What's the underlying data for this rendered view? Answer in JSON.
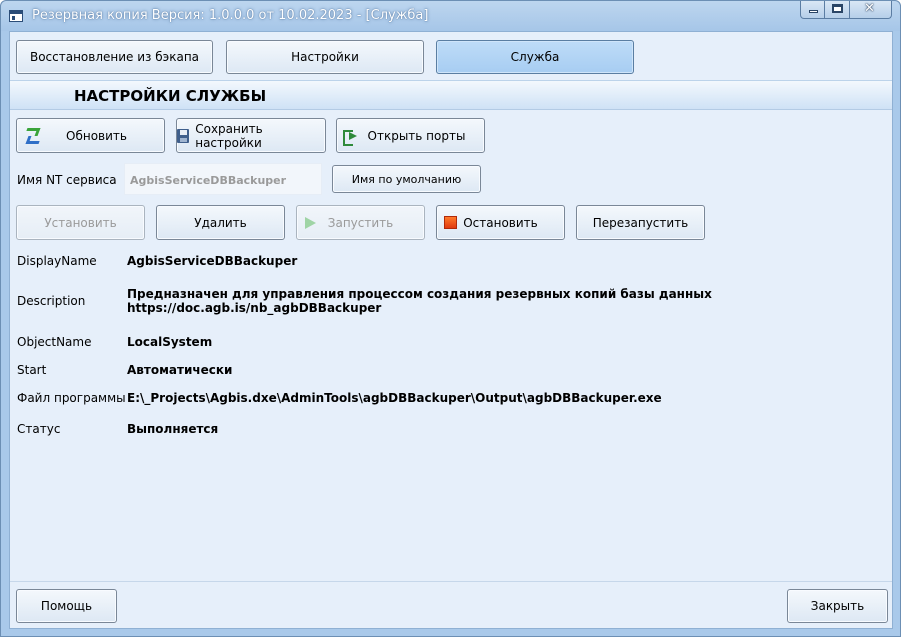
{
  "window": {
    "title": "Резервная копия   Версия: 1.0.0.0 от 10.02.2023 - [Служба]",
    "close_glyph": "✕"
  },
  "tabs": [
    {
      "label": "Восстановление из бэкапа",
      "active": false
    },
    {
      "label": "Настройки",
      "active": false
    },
    {
      "label": "Служба",
      "active": true
    }
  ],
  "section": {
    "title": "НАСТРОЙКИ СЛУЖБЫ"
  },
  "toolbar": {
    "refresh": {
      "label": "Обновить",
      "icon": "refresh-icon"
    },
    "save": {
      "label": "Сохранить настройки",
      "icon": "save-icon"
    },
    "ports": {
      "label": "Открыть порты",
      "icon": "ports-icon"
    }
  },
  "nt_service": {
    "label": "Имя NT сервиса",
    "value": "AgbisServiceDBBackuper",
    "default_button": "Имя по умолчанию"
  },
  "service_actions": {
    "install": {
      "label": "Установить",
      "enabled": false
    },
    "delete": {
      "label": "Удалить",
      "enabled": true
    },
    "start": {
      "label": "Запустить",
      "enabled": false,
      "icon": "play-icon"
    },
    "stop": {
      "label": "Остановить",
      "enabled": true,
      "icon": "stop-icon"
    },
    "restart": {
      "label": "Перезапустить",
      "enabled": true
    }
  },
  "details": {
    "display_name": {
      "label": "DisplayName",
      "value": "AgbisServiceDBBackuper"
    },
    "description": {
      "label": "Description",
      "value_line1": "Предназначен для управления процессом создания резервных копий базы данных",
      "value_line2": "https://doc.agb.is/nb_agbDBBackuper"
    },
    "object_name": {
      "label": "ObjectName",
      "value": "LocalSystem"
    },
    "start": {
      "label": "Start",
      "value": "Автоматически"
    },
    "program_file": {
      "label": "Файл программы",
      "value": "E:\\_Projects\\Agbis.dxe\\AdminTools\\agbDBBackuper\\Output\\agbDBBackuper.exe"
    },
    "status": {
      "label": "Статус",
      "value": "Выполняется"
    }
  },
  "footer": {
    "help": "Помощь",
    "close": "Закрыть"
  },
  "colors": {
    "frame": "#a9c9ea",
    "client": "#e6effa",
    "active_tab": "#bedcf8"
  }
}
